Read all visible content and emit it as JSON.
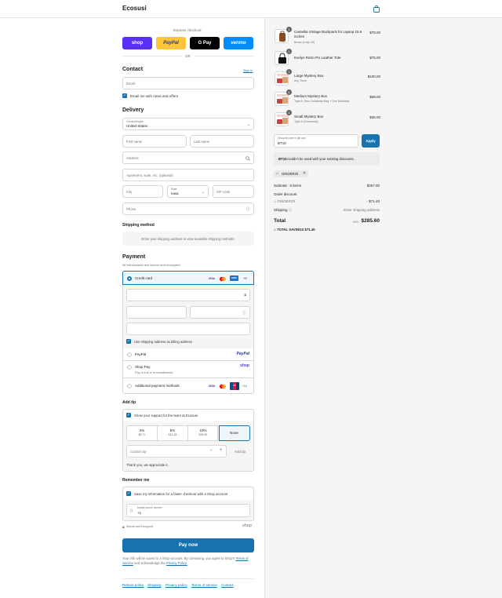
{
  "header": {
    "brand": "Ecosusi",
    "bag_icon": "shopping-bag-icon"
  },
  "express": {
    "title": "Express checkout",
    "or": "OR",
    "buttons": [
      {
        "label": "shop",
        "bg": "#5a31f4",
        "fg": "#ffffff"
      },
      {
        "label": "PayPal",
        "bg": "#ffc439",
        "fg": "#253b80"
      },
      {
        "label": "G Pay",
        "bg": "#000000",
        "fg": "#ffffff"
      },
      {
        "label": "venmo",
        "bg": "#008cff",
        "fg": "#ffffff"
      }
    ]
  },
  "contact": {
    "title": "Contact",
    "signin": "Sign in",
    "email_placeholder": "Email",
    "newsletter": "Email me with news and offers"
  },
  "delivery": {
    "title": "Delivery",
    "country_label": "Country/Region",
    "country_value": "United States",
    "first_name": "First name",
    "last_name": "Last name",
    "address": "Address",
    "apartment": "Apartment, suite, etc. (optional)",
    "city": "City",
    "state_label": "State",
    "state_value": "Iowa",
    "zip": "ZIP code",
    "phone": "Phone"
  },
  "shipping": {
    "title": "Shipping method",
    "notice": "Enter your shipping address to view available shipping methods."
  },
  "payment": {
    "title": "Payment",
    "subtitle": "All transactions are secure and encrypted.",
    "credit_card": "Credit card",
    "more_cards": "+5",
    "billing_same": "Use shipping address as billing address",
    "paypal": "PayPal",
    "shop_pay": "Shop Pay",
    "shop_pay_sub": "Pay in full or in installments",
    "shop_logo": "shop",
    "additional": "Additional payment methods",
    "more_methods": "+16"
  },
  "tip": {
    "title": "Add tip",
    "support": "Show your support for the team at Ecosusi",
    "options": [
      {
        "pct": "2%",
        "amt": "$5.71"
      },
      {
        "pct": "5%",
        "amt": "$14.28"
      },
      {
        "pct": "10%",
        "amt": "$28.56"
      },
      {
        "pct": "None",
        "amt": ""
      }
    ],
    "custom_placeholder": "Custom tip",
    "minus": "−",
    "plus": "+",
    "add_button": "Add tip",
    "thanks": "Thank you, we appreciate it."
  },
  "remember": {
    "title": "Remember me",
    "save_info": "Save my information for a faster checkout with a Shop account",
    "mobile_label": "Mobile phone number",
    "mobile_value": "+1",
    "secure": "Secure and encrypted",
    "shop_logo": "shop"
  },
  "pay_button": "Pay now",
  "terms": {
    "text1": "Your info will be saved to a Shop account. By continuing, you agree to Shop's",
    "link1": "Terms of Service",
    "text2": "and acknowledge the",
    "link2": "Privacy Policy."
  },
  "footer_links": [
    "Refund policy",
    "Shipping",
    "Privacy policy",
    "Terms of service",
    "Contact"
  ],
  "cart": {
    "items": [
      {
        "qty": "1",
        "name": "Camellia Vintage Backpack for Laptop 15.6 inches",
        "variant": "Brown (Only US)",
        "price": "$78.00",
        "thumb_color": "#8b4a24"
      },
      {
        "qty": "1",
        "name": "Evelyn Retro PU Leather Tote",
        "variant": "",
        "price": "$75.00",
        "thumb_color": "#111111"
      },
      {
        "qty": "1",
        "name": "Large Mystery Box",
        "variant": "Any Three",
        "price": "$100.00",
        "thumb_color": "#c9433a"
      },
      {
        "qty": "1",
        "name": "Medium Mystery Box",
        "variant": "Type A: One Crossbody Bag + One Briefcase",
        "price": "$69.00",
        "thumb_color": "#c9433a"
      },
      {
        "qty": "1",
        "name": "Small Mystery Box",
        "variant": "Type A (Crossbody)",
        "price": "$35.00",
        "thumb_color": "#c9433a"
      }
    ],
    "discount_label": "Discount code or gift card",
    "discount_value": "BT10",
    "apply": "Apply",
    "error_code": "BT10",
    "error_rest": " couldn't be used with your existing discounts.",
    "applied_code": "GINGER20",
    "subtotal_label": "Subtotal · 5 items",
    "subtotal": "$357.00",
    "order_discount": "Order discount",
    "discount_code": "GINGER20",
    "discount_amount": "- $71.40",
    "shipping_label": "Shipping",
    "shipping_value": "Enter shipping address",
    "total_label": "Total",
    "currency": "USD",
    "total": "$285.60",
    "savings_label": "TOTAL SAVINGS",
    "savings": "$71.40"
  }
}
